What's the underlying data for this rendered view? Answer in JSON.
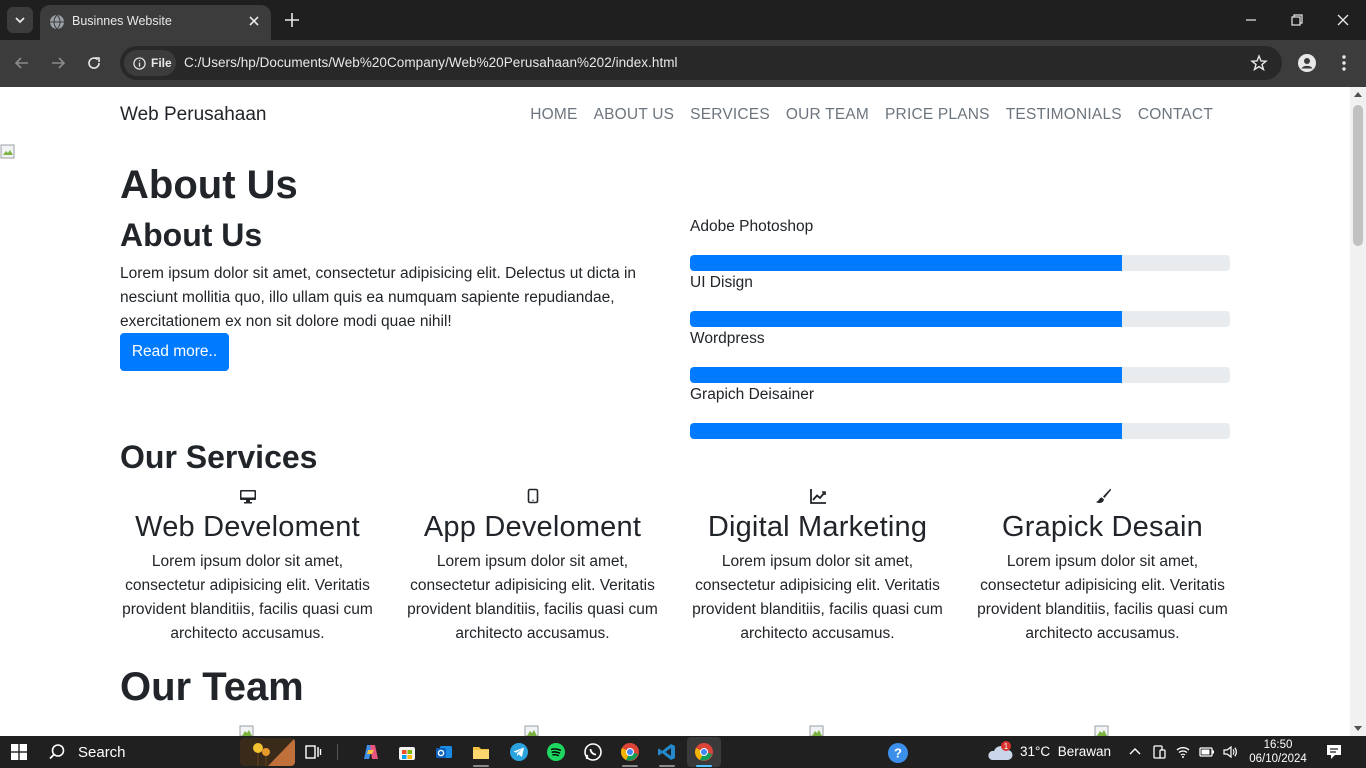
{
  "browser": {
    "tab_title": "Businnes Website",
    "site_chip": "File",
    "url": "C:/Users/hp/Documents/Web%20Company/Web%20Perusahaan%202/index.html"
  },
  "site": {
    "brand": "Web Perusahaan",
    "nav": [
      "HOME",
      "ABOUT US",
      "SERVICES",
      "OUR TEAM",
      "PRICE PLANS",
      "TESTIMONIALS",
      "CONTACT"
    ]
  },
  "about": {
    "heading_main": "About Us",
    "heading_sub": "About Us",
    "text": "Lorem ipsum dolor sit amet, consectetur adipisicing elit. Delectus ut dicta in nesciunt mollitia quo, illo ullam quis ea numquam sapiente repudiandae, exercitationem ex non sit dolore modi quae nihil!",
    "button": "Read more..",
    "skills": [
      {
        "label": "Adobe Photoshop",
        "percent": 80
      },
      {
        "label": "UI Disign",
        "percent": 80
      },
      {
        "label": "Wordpress",
        "percent": 80
      },
      {
        "label": "Grapich Deisainer",
        "percent": 80
      }
    ]
  },
  "services": {
    "heading": "Our Services",
    "items": [
      {
        "icon": "desktop-icon",
        "title": "Web Develoment",
        "desc": "Lorem ipsum dolor sit amet, consectetur adipisicing elit. Veritatis provident blanditiis, facilis quasi cum architecto accusamus."
      },
      {
        "icon": "tablet-icon",
        "title": "App Develoment",
        "desc": "Lorem ipsum dolor sit amet, consectetur adipisicing elit. Veritatis provident blanditiis, facilis quasi cum architecto accusamus."
      },
      {
        "icon": "chart-line-icon",
        "title": "Digital Marketing",
        "desc": "Lorem ipsum dolor sit amet, consectetur adipisicing elit. Veritatis provident blanditiis, facilis quasi cum architecto accusamus."
      },
      {
        "icon": "paint-brush-icon",
        "title": "Grapick Desain",
        "desc": "Lorem ipsum dolor sit amet, consectetur adipisicing elit. Veritatis provident blanditiis, facilis quasi cum architecto accusamus."
      }
    ]
  },
  "team": {
    "heading": "Our Team"
  },
  "taskbar": {
    "search": "Search",
    "weather_temp": "31°C",
    "weather_desc": "Berawan",
    "time": "16:50",
    "date": "06/10/2024",
    "notification_count": "1"
  },
  "colors": {
    "accent": "#007bff",
    "chrome_dark": "#1f1f1f",
    "chrome_toolbar": "#3c3c3c",
    "taskbar": "#202020"
  }
}
